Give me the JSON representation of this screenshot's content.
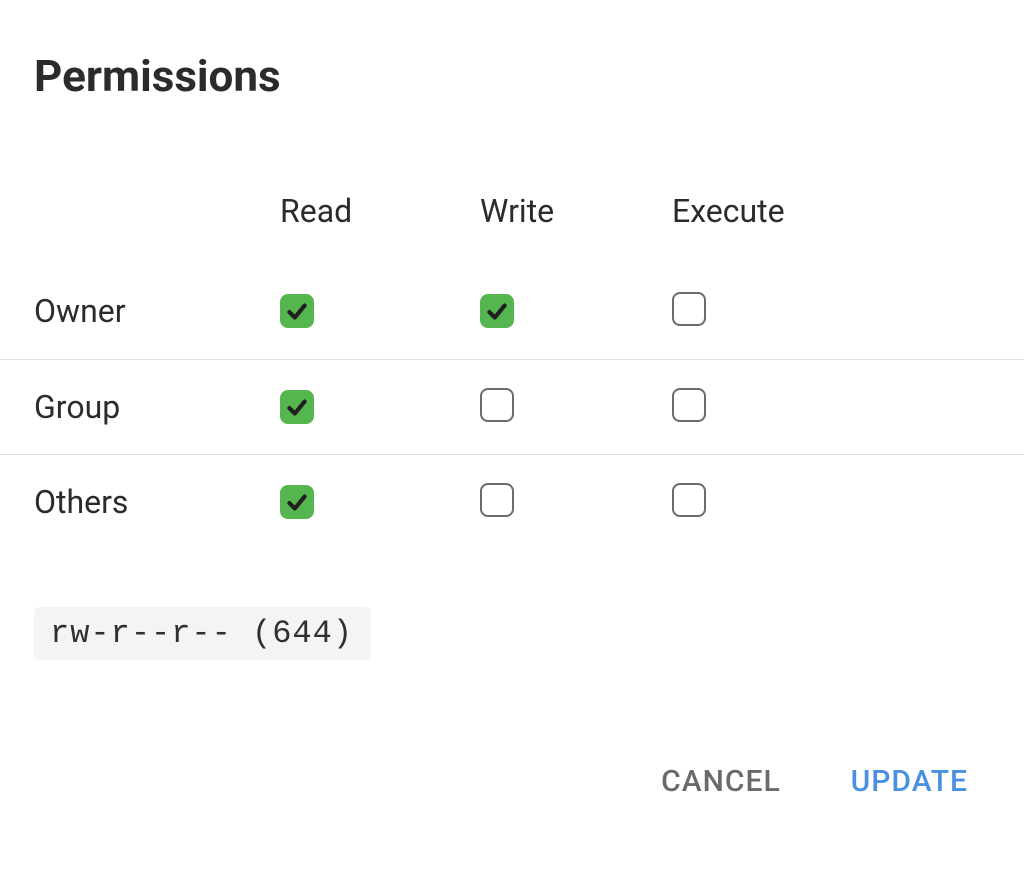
{
  "title": "Permissions",
  "columns": {
    "read": "Read",
    "write": "Write",
    "execute": "Execute"
  },
  "rows": [
    {
      "label": "Owner",
      "read": true,
      "write": true,
      "execute": false
    },
    {
      "label": "Group",
      "read": true,
      "write": false,
      "execute": false
    },
    {
      "label": "Others",
      "read": true,
      "write": false,
      "execute": false
    }
  ],
  "mode_string": "rw-r--r-- (644)",
  "buttons": {
    "cancel": "CANCEL",
    "update": "UPDATE"
  },
  "colors": {
    "accent_green": "#55b54e",
    "accent_blue": "#4a90e2",
    "muted": "#6a6a6a"
  }
}
